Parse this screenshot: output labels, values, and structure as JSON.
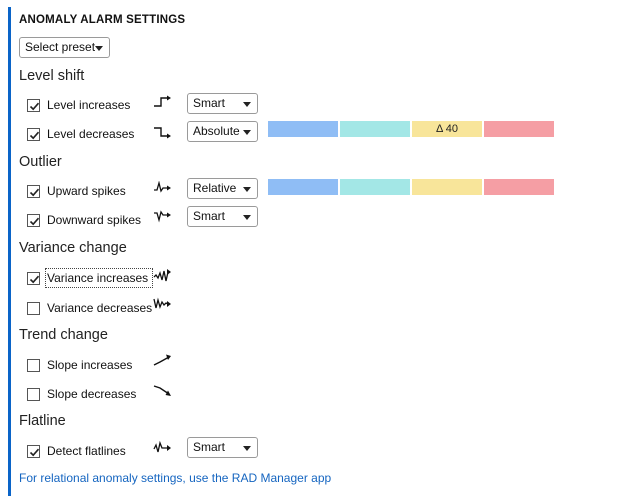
{
  "header": {
    "title": "ANOMALY ALARM SETTINGS"
  },
  "preset": {
    "label": "Select preset"
  },
  "sections": {
    "level_shift": {
      "title": "Level shift",
      "level_increases": {
        "label": "Level increases",
        "checked": true,
        "icon": "step-up-icon",
        "mode": "Smart"
      },
      "level_decreases": {
        "label": "Level decreases",
        "checked": true,
        "icon": "step-down-icon",
        "mode": "Absolute",
        "threshold_segments": [
          "",
          "",
          "Δ 40",
          ""
        ]
      }
    },
    "outlier": {
      "title": "Outlier",
      "upward_spikes": {
        "label": "Upward spikes",
        "checked": true,
        "icon": "spike-up-icon",
        "mode": "Relative",
        "threshold_segments": [
          "",
          "",
          "",
          ""
        ]
      },
      "downward_spikes": {
        "label": "Downward spikes",
        "checked": true,
        "icon": "spike-down-icon",
        "mode": "Smart"
      }
    },
    "variance_change": {
      "title": "Variance change",
      "variance_increases": {
        "label": "Variance increases",
        "checked": true,
        "icon": "variance-up-icon"
      },
      "variance_decreases": {
        "label": "Variance decreases",
        "checked": false,
        "icon": "variance-down-icon"
      }
    },
    "trend_change": {
      "title": "Trend change",
      "slope_increases": {
        "label": "Slope increases",
        "checked": false,
        "icon": "slope-up-icon"
      },
      "slope_decreases": {
        "label": "Slope decreases",
        "checked": false,
        "icon": "slope-down-icon"
      }
    },
    "flatline": {
      "title": "Flatline",
      "detect_flatlines": {
        "label": "Detect flatlines",
        "checked": true,
        "icon": "flatline-icon",
        "mode": "Smart"
      }
    }
  },
  "threshold_colors": [
    "#8fbdf5",
    "#a3e7e6",
    "#f8e59a",
    "#f59ea4"
  ],
  "colors": {
    "accent": "#0a64c8",
    "link": "#1565c0"
  },
  "footer": {
    "link_text": "For relational anomaly settings, use the RAD Manager app"
  }
}
